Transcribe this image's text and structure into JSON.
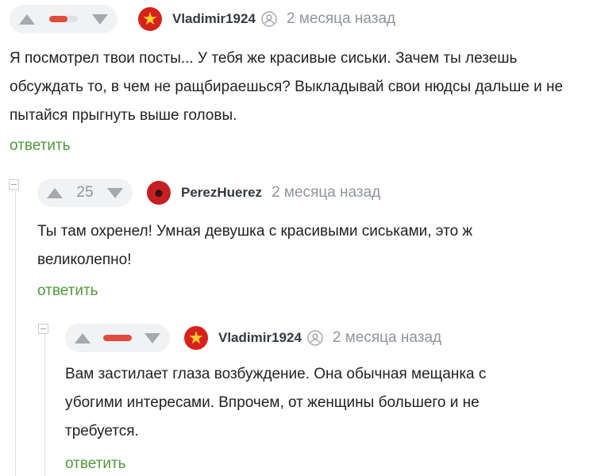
{
  "comments": [
    {
      "user": "Vladimir1924",
      "time": "2 месяца назад",
      "score": "",
      "text": "Я посмотрел твои посты... У тебя же красивые сиськи. Зачем ты лезешь обсуждать то, в чем не ращбираешься? Выкладывай свои нюдсы дальше и не пытайся прыгнуть выше головы.",
      "reply_label": "ответить"
    },
    {
      "user": "PerezHuerez",
      "time": "2 месяца назад",
      "score": "25",
      "text": "Ты там охренел! Умная девушка с красивыми сиськами, это ж великолепно!",
      "reply_label": "ответить"
    },
    {
      "user": "Vladimir1924",
      "time": "2 месяца назад",
      "score": "",
      "text": "Вам застилает глаза возбуждение. Она обычная мещанка с убогими интересами. Впрочем, от женщины большего и не требуется.",
      "reply_label": "ответить"
    }
  ],
  "icons": {
    "upvote": "triangle-up-icon",
    "downvote": "triangle-down-icon",
    "avatar_star": "red-star-icon",
    "user_badge": "person-circle-icon",
    "collapse": "minus-box-icon"
  },
  "colors": {
    "reply_link": "#4f9a3c",
    "score_bar": "#e24a3b",
    "meta": "#8f959b"
  }
}
